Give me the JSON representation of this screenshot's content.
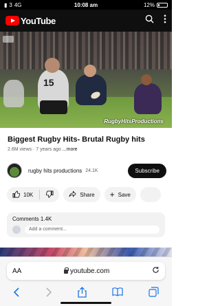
{
  "status_bar": {
    "signal": "3",
    "network": "4G",
    "time": "10:08 am",
    "battery": "12%"
  },
  "header": {
    "app_name": "YouTube",
    "icons": [
      "search-icon",
      "more-icon"
    ]
  },
  "video": {
    "watermark": "RugbyHitsProductions",
    "jersey_number": "15"
  },
  "info": {
    "title": "Biggest Rugby Hits- Brutal Rugby hits",
    "views": "2.6M views",
    "age": "7 years ago",
    "more": "...more"
  },
  "channel": {
    "name": "rugby hits productions",
    "subscribers": "24.1K",
    "subscribe_label": "Subscribe"
  },
  "actions": {
    "likes": "10K",
    "share_label": "Share",
    "save_label": "Save"
  },
  "comments": {
    "header": "Comments 1.4K",
    "placeholder": "Add a comment..."
  },
  "browser": {
    "aa_label": "AA",
    "url": "youtube.com"
  },
  "colors": {
    "brand_red": "#ff0000",
    "ios_blue": "#1a73e8"
  }
}
